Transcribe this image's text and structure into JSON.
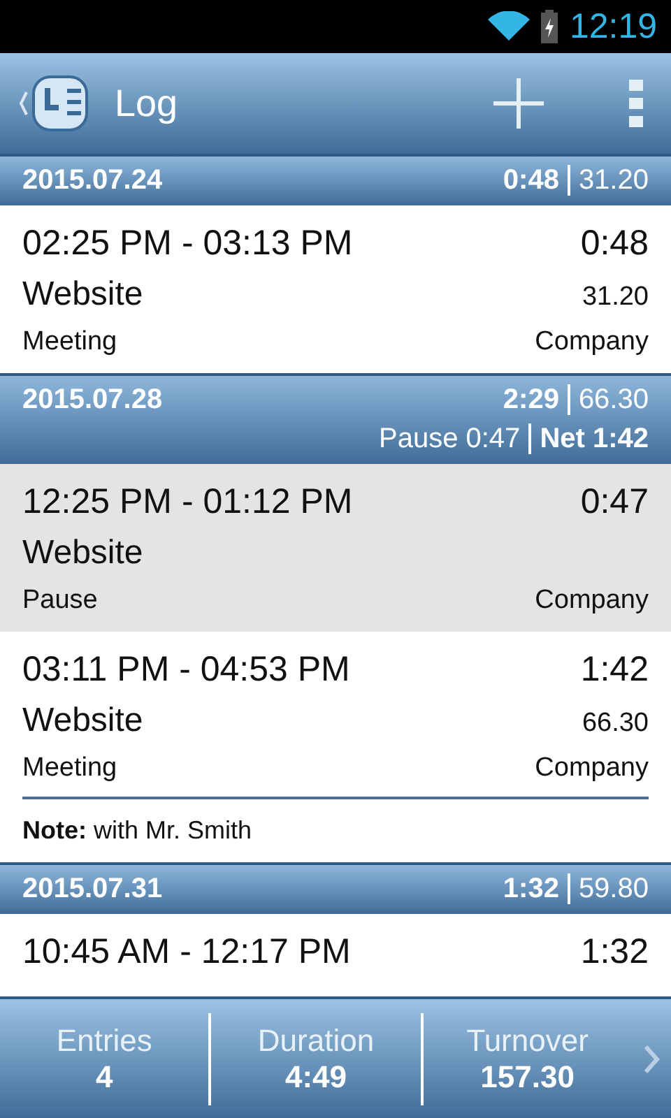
{
  "status_bar": {
    "time": "12:19"
  },
  "action_bar": {
    "title": "Log"
  },
  "days": [
    {
      "date": "2015.07.24",
      "duration": "0:48",
      "amount": "31.20",
      "entries": [
        {
          "time": "02:25 PM - 03:13 PM",
          "duration": "0:48",
          "project": "Website",
          "amount": "31.20",
          "activity": "Meeting",
          "client": "Company",
          "selected": false
        }
      ]
    },
    {
      "date": "2015.07.28",
      "duration": "2:29",
      "amount": "66.30",
      "pause": "Pause 0:47",
      "net": "Net 1:42",
      "entries": [
        {
          "time": "12:25 PM - 01:12 PM",
          "duration": "0:47",
          "project": "Website",
          "activity": "Pause",
          "client": "Company",
          "selected": true
        },
        {
          "time": "03:11 PM - 04:53 PM",
          "duration": "1:42",
          "project": "Website",
          "amount": "66.30",
          "activity": "Meeting",
          "client": "Company",
          "selected": false,
          "note": "**Note:** with Mr. Smith"
        }
      ]
    },
    {
      "date": "2015.07.31",
      "duration": "1:32",
      "amount": "59.80",
      "entries": [
        {
          "time": "10:45 AM - 12:17 PM",
          "duration": "1:32",
          "selected": false
        }
      ]
    }
  ],
  "summary": [
    {
      "label": "Entries",
      "value": "4"
    },
    {
      "label": "Duration",
      "value": "4:49"
    },
    {
      "label": "Turnover",
      "value": "157.30"
    }
  ]
}
